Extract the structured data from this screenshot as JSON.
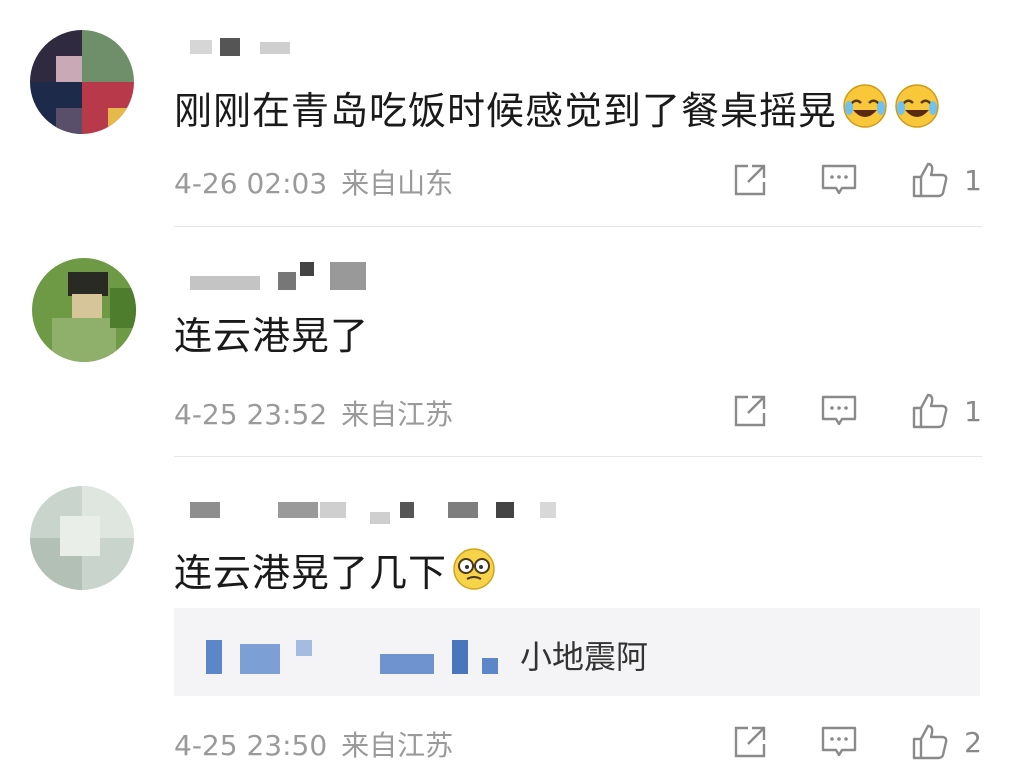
{
  "comments": [
    {
      "text": "刚刚在青岛吃饭时候感觉到了餐桌摇晃",
      "emoji": [
        "laughing-crying-emoji",
        "laughing-crying-emoji"
      ],
      "date": "4-26 02:03",
      "location": "来自山东",
      "likes": "1"
    },
    {
      "text": "连云港晃了",
      "emoji": [],
      "date": "4-25 23:52",
      "location": "来自江苏",
      "likes": "1"
    },
    {
      "text": "连云港晃了几下",
      "emoji": [
        "grimace-glasses-emoji"
      ],
      "reply": {
        "text": "小地震阿"
      },
      "date": "4-25 23:50",
      "location": "来自江苏",
      "likes": "2"
    }
  ],
  "icons": {
    "share": "share-icon",
    "comment": "comment-icon",
    "like": "thumbs-up-icon"
  },
  "colors": {
    "meta": "#9a9a9a",
    "icon": "#8a8a8a",
    "reply_bg": "#f4f4f6"
  }
}
